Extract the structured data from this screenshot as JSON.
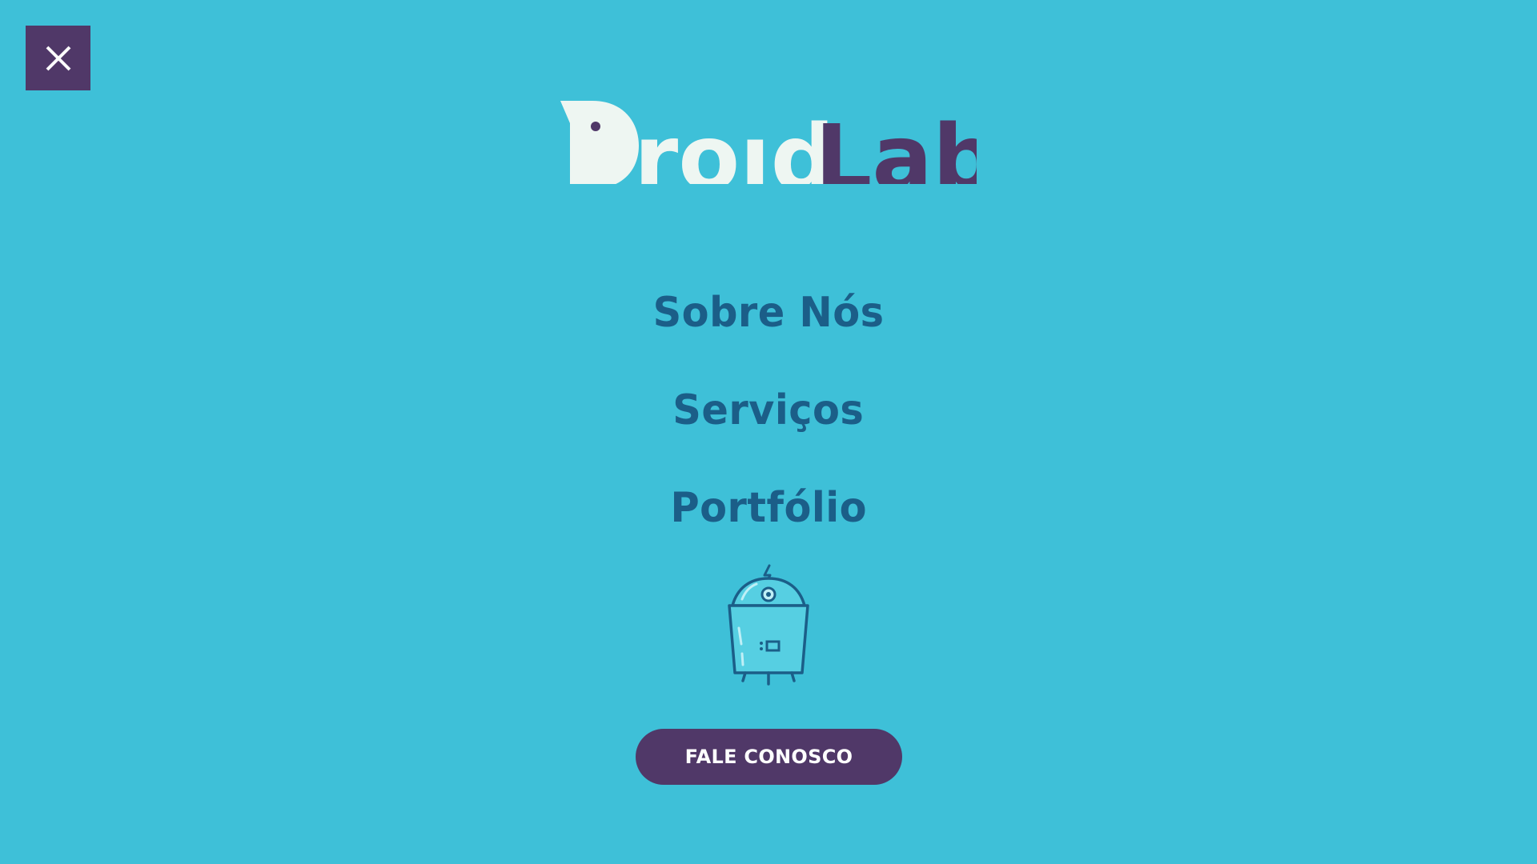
{
  "menu": {
    "close_icon": "close-icon"
  },
  "logo": {
    "word1": "Droid",
    "word2": "Lab",
    "color_word1": "#eef6f2",
    "color_word2": "#503868"
  },
  "nav": {
    "items": [
      {
        "label": "Sobre Nós"
      },
      {
        "label": "Serviços"
      },
      {
        "label": "Portfólio"
      }
    ]
  },
  "mascot": {
    "icon": "robot-icon"
  },
  "cta": {
    "label": "FALE CONOSCO"
  },
  "colors": {
    "background": "#3ec0d8",
    "accent": "#503868",
    "nav_text": "#1b5e88"
  }
}
